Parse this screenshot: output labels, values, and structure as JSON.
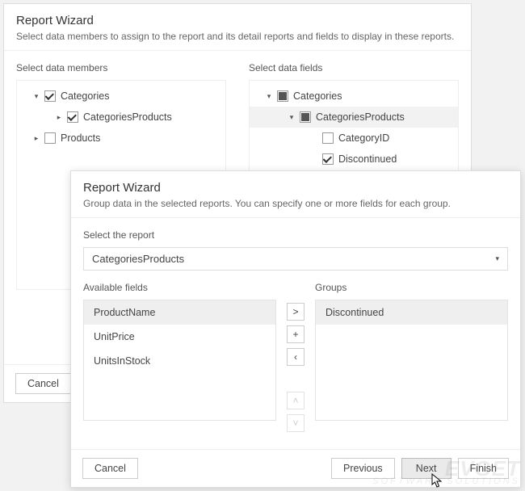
{
  "d1": {
    "title": "Report Wizard",
    "subtitle": "Select data members to assign to the report and its detail reports and fields to display in these reports.",
    "members_label": "Select data members",
    "fields_label": "Select data fields",
    "members": [
      {
        "label": "Categories",
        "level": 0,
        "checked": "on",
        "expander": "down"
      },
      {
        "label": "CategoriesProducts",
        "level": 1,
        "checked": "on",
        "expander": "right"
      },
      {
        "label": "Products",
        "level": 0,
        "checked": "off",
        "expander": "right"
      }
    ],
    "fields": [
      {
        "label": "Categories",
        "level": 0,
        "checked": "mixed",
        "expander": "down",
        "selected": false
      },
      {
        "label": "CategoriesProducts",
        "level": 1,
        "checked": "mixed",
        "expander": "down",
        "selected": true
      },
      {
        "label": "CategoryID",
        "level": 2,
        "checked": "off",
        "expander": "",
        "selected": false
      },
      {
        "label": "Discontinued",
        "level": 2,
        "checked": "on",
        "expander": "",
        "selected": false
      }
    ],
    "cancel": "Cancel"
  },
  "d2": {
    "title": "Report Wizard",
    "subtitle": "Group data in the selected reports. You can specify one or more fields for each group.",
    "select_label": "Select the report",
    "select_value": "CategoriesProducts",
    "avail_label": "Available fields",
    "groups_label": "Groups",
    "avail": [
      "ProductName",
      "UnitPrice",
      "UnitsInStock"
    ],
    "avail_selected": 0,
    "groups": [
      "Discontinued"
    ],
    "groups_selected": 0,
    "btns": {
      "add": ">",
      "addall": "+",
      "rem": "‹",
      "up": "˄",
      "down": "˅"
    },
    "cancel": "Cancel",
    "prev": "Previous",
    "next": "Next",
    "finish": "Finish"
  },
  "watermark": {
    "big": "EVGET",
    "small": "SOFTWARE SOLUTIONS"
  }
}
